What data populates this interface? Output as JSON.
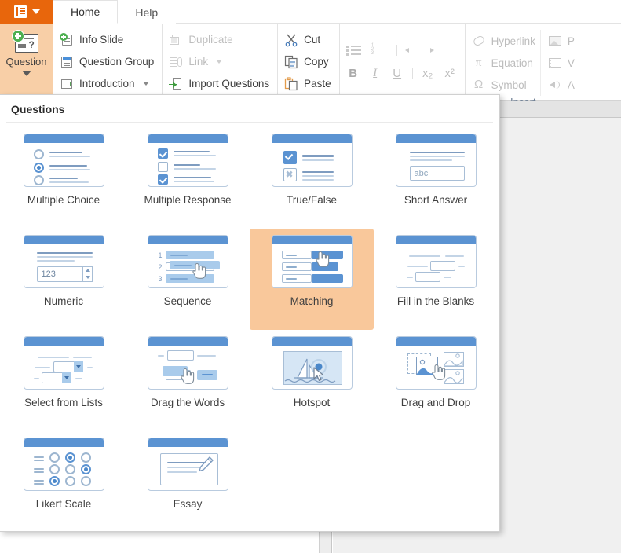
{
  "window": {
    "file_menu_icon": "document-menu-icon",
    "tabs": [
      {
        "label": "Home",
        "active": true
      },
      {
        "label": "Help",
        "active": false
      }
    ]
  },
  "ribbon": {
    "question_button": {
      "label": "Question",
      "icon": "question-slide-icon",
      "caret": "chevron-down-icon",
      "active": true
    },
    "group_slides": [
      {
        "label": "Info Slide",
        "icon": "info-slide-icon",
        "enabled": true,
        "has_caret": false
      },
      {
        "label": "Question Group",
        "icon": "question-group-icon",
        "enabled": true,
        "has_caret": false
      },
      {
        "label": "Introduction",
        "icon": "introduction-icon",
        "enabled": true,
        "has_caret": true
      }
    ],
    "group_edit": [
      {
        "label": "Duplicate",
        "icon": "duplicate-icon",
        "enabled": false,
        "has_caret": false
      },
      {
        "label": "Link",
        "icon": "link-icon",
        "enabled": false,
        "has_caret": true
      },
      {
        "label": "Import Questions",
        "icon": "import-questions-icon",
        "enabled": true,
        "has_caret": false
      }
    ],
    "group_clipboard": [
      {
        "label": "Cut",
        "icon": "scissors-icon",
        "enabled": true
      },
      {
        "label": "Copy",
        "icon": "copy-icon",
        "enabled": true
      },
      {
        "label": "Paste",
        "icon": "clipboard-icon",
        "enabled": true
      }
    ],
    "group_format": {
      "list_row": [
        {
          "name": "bulleted-list-icon"
        },
        {
          "name": "numbered-list-icon"
        },
        {
          "name": "decrease-indent-icon"
        },
        {
          "name": "increase-indent-icon"
        }
      ],
      "text_row": [
        {
          "label": "B",
          "name": "bold-icon"
        },
        {
          "label": "I",
          "name": "italic-icon"
        },
        {
          "label": "U",
          "name": "underline-icon"
        },
        {
          "label": "x₂",
          "name": "subscript-icon"
        },
        {
          "label": "x²",
          "name": "superscript-icon"
        }
      ]
    },
    "group_insert": {
      "caption": "Insert",
      "column_a": [
        {
          "label": "Hyperlink",
          "icon": "hyperlink-icon",
          "enabled": false
        },
        {
          "label": "Equation",
          "icon": "equation-icon",
          "enabled": false
        },
        {
          "label": "Symbol",
          "icon": "symbol-icon",
          "enabled": false
        }
      ],
      "column_b": [
        {
          "label": "P",
          "icon": "picture-icon",
          "enabled": false
        },
        {
          "label": "V",
          "icon": "video-icon",
          "enabled": false
        },
        {
          "label": "A",
          "icon": "audio-icon",
          "enabled": false
        }
      ]
    }
  },
  "gallery": {
    "title": "Questions",
    "selected": "Matching",
    "tiles": [
      {
        "label": "Multiple Choice",
        "art": "multiple-choice",
        "selected": false
      },
      {
        "label": "Multiple Response",
        "art": "multiple-response",
        "selected": false
      },
      {
        "label": "True/False",
        "art": "true-false",
        "selected": false
      },
      {
        "label": "Short Answer",
        "art": "short-answer",
        "selected": false
      },
      {
        "label": "Numeric",
        "art": "numeric",
        "selected": false
      },
      {
        "label": "Sequence",
        "art": "sequence",
        "selected": false
      },
      {
        "label": "Matching",
        "art": "matching",
        "selected": true
      },
      {
        "label": "Fill in the Blanks",
        "art": "fill-blanks",
        "selected": false
      },
      {
        "label": "Select from Lists",
        "art": "select-lists",
        "selected": false
      },
      {
        "label": "Drag the Words",
        "art": "drag-words",
        "selected": false
      },
      {
        "label": "Hotspot",
        "art": "hotspot",
        "selected": false
      },
      {
        "label": "Drag and Drop",
        "art": "drag-drop",
        "selected": false
      },
      {
        "label": "Likert Scale",
        "art": "likert",
        "selected": false
      },
      {
        "label": "Essay",
        "art": "essay",
        "selected": false
      }
    ]
  },
  "colors": {
    "accent_orange": "#E8660C",
    "highlight_peach": "#F9C89B",
    "tile_blue": "#5B93D2",
    "tile_border": "#B9CBDF",
    "panel_bg": "#FFFFFF",
    "canvas_bg": "#F0F0F0"
  }
}
